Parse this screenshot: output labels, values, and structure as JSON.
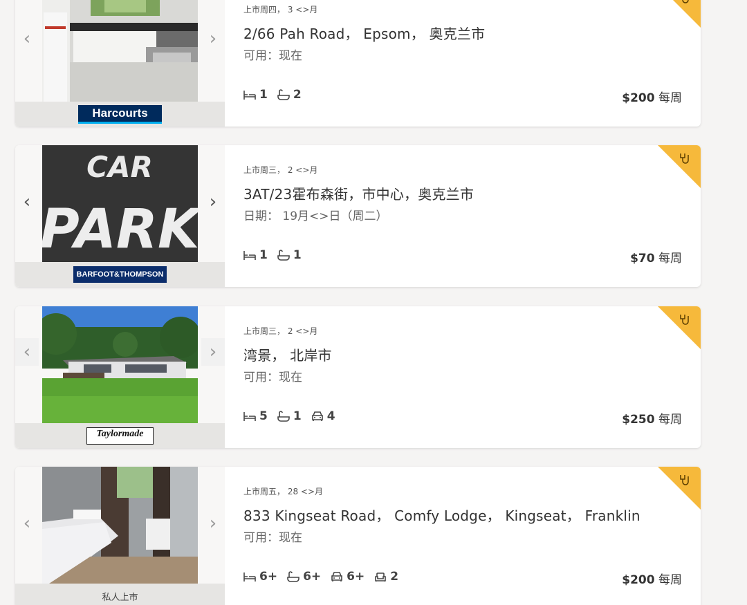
{
  "listings": [
    {
      "listed": "上市周四， 3 <>月",
      "address": "2/66 Pah Road， Epsom， 奥克兰市",
      "availability": "可用：现在",
      "beds": "1",
      "baths": "2",
      "price": "$200",
      "price_unit": "每周",
      "agency": "Harcourts"
    },
    {
      "listed": "上市周三， 2 <>月",
      "address": "3AT/23霍布森街，市中心，奥克兰市",
      "availability": "日期： 19月<>日（周二）",
      "beds": "1",
      "baths": "1",
      "price": "$70",
      "price_unit": "每周",
      "agency": "BARFOOT&THOMPSON",
      "photo_text_1": "CAR",
      "photo_text_2": "PARK"
    },
    {
      "listed": "上市周三， 2 <>月",
      "address": "湾景， 北岸市",
      "availability": "可用：现在",
      "beds": "5",
      "baths": "1",
      "cars": "4",
      "price": "$250",
      "price_unit": "每周",
      "agency": "Taylormade"
    },
    {
      "listed": "上市周五， 28 <>月",
      "address": "833 Kingseat Road， Comfy Lodge， Kingseat， Franklin",
      "availability": "可用：现在",
      "beds": "6+",
      "baths": "6+",
      "cars": "6+",
      "lounges": "2",
      "price": "$200",
      "price_unit": "每周",
      "agency": "私人上市"
    }
  ],
  "ui": {
    "prev_glyph": "‹",
    "next_glyph": "›",
    "accent": "#f6b93b",
    "icons": [
      "bed-icon",
      "bath-icon",
      "car-icon",
      "lounge-icon",
      "shortlist-add-icon"
    ]
  }
}
